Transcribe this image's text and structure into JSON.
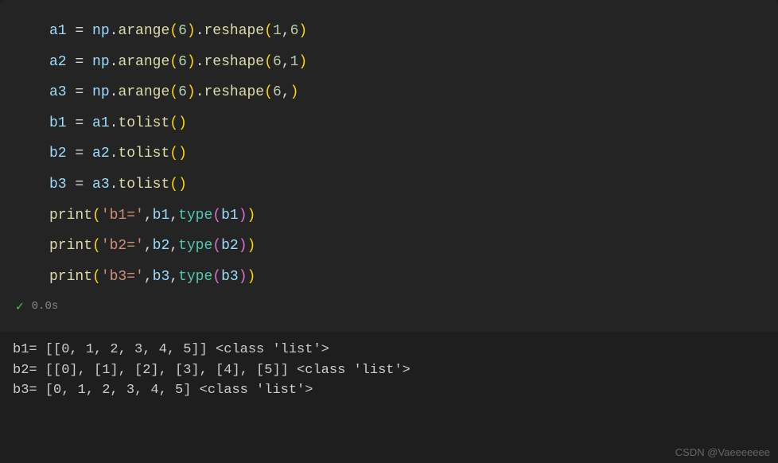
{
  "code": {
    "lines": [
      [
        {
          "t": "a1 ",
          "c": "v"
        },
        {
          "t": "=",
          "c": "op"
        },
        {
          "t": " np",
          "c": "v"
        },
        {
          "t": ".",
          "c": "w"
        },
        {
          "t": "arange",
          "c": "fn"
        },
        {
          "t": "(",
          "c": "paren"
        },
        {
          "t": "6",
          "c": "num"
        },
        {
          "t": ")",
          "c": "paren"
        },
        {
          "t": ".",
          "c": "w"
        },
        {
          "t": "reshape",
          "c": "fn"
        },
        {
          "t": "(",
          "c": "paren"
        },
        {
          "t": "1",
          "c": "num"
        },
        {
          "t": ",",
          "c": "w"
        },
        {
          "t": "6",
          "c": "num"
        },
        {
          "t": ")",
          "c": "paren"
        }
      ],
      [
        {
          "t": "a2 ",
          "c": "v"
        },
        {
          "t": "=",
          "c": "op"
        },
        {
          "t": " np",
          "c": "v"
        },
        {
          "t": ".",
          "c": "w"
        },
        {
          "t": "arange",
          "c": "fn"
        },
        {
          "t": "(",
          "c": "paren"
        },
        {
          "t": "6",
          "c": "num"
        },
        {
          "t": ")",
          "c": "paren"
        },
        {
          "t": ".",
          "c": "w"
        },
        {
          "t": "reshape",
          "c": "fn"
        },
        {
          "t": "(",
          "c": "paren"
        },
        {
          "t": "6",
          "c": "num"
        },
        {
          "t": ",",
          "c": "w"
        },
        {
          "t": "1",
          "c": "num"
        },
        {
          "t": ")",
          "c": "paren"
        }
      ],
      [
        {
          "t": "a3 ",
          "c": "v"
        },
        {
          "t": "=",
          "c": "op"
        },
        {
          "t": " np",
          "c": "v"
        },
        {
          "t": ".",
          "c": "w"
        },
        {
          "t": "arange",
          "c": "fn"
        },
        {
          "t": "(",
          "c": "paren"
        },
        {
          "t": "6",
          "c": "num"
        },
        {
          "t": ")",
          "c": "paren"
        },
        {
          "t": ".",
          "c": "w"
        },
        {
          "t": "reshape",
          "c": "fn"
        },
        {
          "t": "(",
          "c": "paren"
        },
        {
          "t": "6",
          "c": "num"
        },
        {
          "t": ",",
          "c": "w"
        },
        {
          "t": ")",
          "c": "paren"
        }
      ],
      [
        {
          "t": "b1 ",
          "c": "v"
        },
        {
          "t": "=",
          "c": "op"
        },
        {
          "t": " a1",
          "c": "v"
        },
        {
          "t": ".",
          "c": "w"
        },
        {
          "t": "tolist",
          "c": "fn"
        },
        {
          "t": "(",
          "c": "paren"
        },
        {
          "t": ")",
          "c": "paren"
        }
      ],
      [
        {
          "t": "b2 ",
          "c": "v"
        },
        {
          "t": "=",
          "c": "op"
        },
        {
          "t": " a2",
          "c": "v"
        },
        {
          "t": ".",
          "c": "w"
        },
        {
          "t": "tolist",
          "c": "fn"
        },
        {
          "t": "(",
          "c": "paren"
        },
        {
          "t": ")",
          "c": "paren"
        }
      ],
      [
        {
          "t": "b3 ",
          "c": "v"
        },
        {
          "t": "=",
          "c": "op"
        },
        {
          "t": " a3",
          "c": "v"
        },
        {
          "t": ".",
          "c": "w"
        },
        {
          "t": "tolist",
          "c": "fn"
        },
        {
          "t": "(",
          "c": "paren"
        },
        {
          "t": ")",
          "c": "paren"
        }
      ],
      [
        {
          "t": "print",
          "c": "fn"
        },
        {
          "t": "(",
          "c": "paren"
        },
        {
          "t": "'b1='",
          "c": "str"
        },
        {
          "t": ",",
          "c": "w"
        },
        {
          "t": "b1",
          "c": "v"
        },
        {
          "t": ",",
          "c": "w"
        },
        {
          "t": "type",
          "c": "kw"
        },
        {
          "t": "(",
          "c": "paren2"
        },
        {
          "t": "b1",
          "c": "v"
        },
        {
          "t": ")",
          "c": "paren2"
        },
        {
          "t": ")",
          "c": "paren"
        }
      ],
      [
        {
          "t": "print",
          "c": "fn"
        },
        {
          "t": "(",
          "c": "paren"
        },
        {
          "t": "'b2='",
          "c": "str"
        },
        {
          "t": ",",
          "c": "w"
        },
        {
          "t": "b2",
          "c": "v"
        },
        {
          "t": ",",
          "c": "w"
        },
        {
          "t": "type",
          "c": "kw"
        },
        {
          "t": "(",
          "c": "paren2"
        },
        {
          "t": "b2",
          "c": "v"
        },
        {
          "t": ")",
          "c": "paren2"
        },
        {
          "t": ")",
          "c": "paren"
        }
      ],
      [
        {
          "t": "print",
          "c": "fn"
        },
        {
          "t": "(",
          "c": "paren"
        },
        {
          "t": "'b3='",
          "c": "str"
        },
        {
          "t": ",",
          "c": "w"
        },
        {
          "t": "b3",
          "c": "v"
        },
        {
          "t": ",",
          "c": "w"
        },
        {
          "t": "type",
          "c": "kw"
        },
        {
          "t": "(",
          "c": "paren2"
        },
        {
          "t": "b3",
          "c": "v"
        },
        {
          "t": ")",
          "c": "paren2"
        },
        {
          "t": ")",
          "c": "paren"
        }
      ]
    ]
  },
  "status": {
    "time": "0.0s"
  },
  "output": {
    "lines": [
      "b1= [[0, 1, 2, 3, 4, 5]] <class 'list'>",
      "b2= [[0], [1], [2], [3], [4], [5]] <class 'list'>",
      "b3= [0, 1, 2, 3, 4, 5] <class 'list'>"
    ]
  },
  "watermark": "CSDN @Vaeeeeeee"
}
